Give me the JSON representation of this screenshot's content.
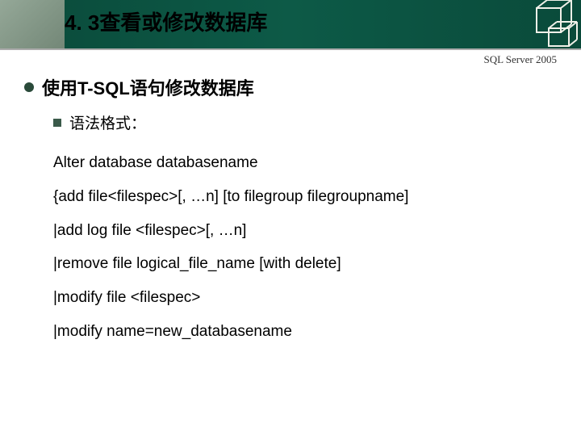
{
  "header": {
    "title": "4. 3查看或修改数据库",
    "subtitle": "SQL Server 2005"
  },
  "bullet1": {
    "text": "使用T-SQL语句修改数据库"
  },
  "subbullet1": {
    "text": "语法格式："
  },
  "code": {
    "line1": "Alter database databasename",
    "line2": "{add file<filespec>[, …n] [to filegroup filegroupname]",
    "line3": "|add log file <filespec>[, …n]",
    "line4": "|remove file logical_file_name [with delete]",
    "line5": "|modify file <filespec>",
    "line6": "|modify name=new_databasename"
  }
}
